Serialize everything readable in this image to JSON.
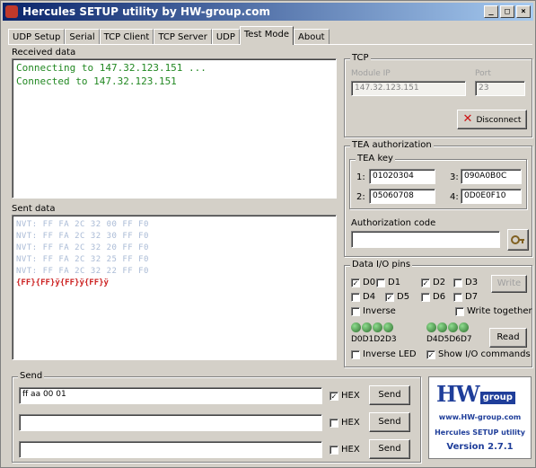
{
  "window": {
    "title": "Hercules SETUP utility by HW-group.com",
    "controls": [
      "_",
      "□",
      "×"
    ]
  },
  "tabs": [
    {
      "label": "UDP Setup",
      "active": false
    },
    {
      "label": "Serial",
      "active": false
    },
    {
      "label": "TCP Client",
      "active": false
    },
    {
      "label": "TCP Server",
      "active": false
    },
    {
      "label": "UDP",
      "active": false
    },
    {
      "label": "Test Mode",
      "active": true
    },
    {
      "label": "About",
      "active": false
    }
  ],
  "received": {
    "label": "Received data",
    "lines": [
      "Connecting to 147.32.123.151 ...",
      "Connected to 147.32.123.151"
    ]
  },
  "sent": {
    "label": "Sent data",
    "lines": [
      "NVT: FF FA 2C 32 00 FF F0",
      "NVT: FF FA 2C 32 30 FF F0",
      "NVT: FF FA 2C 32 20 FF F0",
      "NVT: FF FA 2C 32 25 FF F0",
      "NVT: FF FA 2C 32 22 FF F0"
    ],
    "last_line": "{FF}{FF}ÿ{FF}ÿ{FF}ÿ"
  },
  "tcp": {
    "title": "TCP",
    "module_ip_label": "Module IP",
    "module_ip": "147.32.123.151",
    "port_label": "Port",
    "port": "23",
    "disconnect_label": "Disconnect"
  },
  "tea": {
    "title": "TEA authorization",
    "key_title": "TEA key",
    "keys": [
      {
        "n": "1:",
        "v": "01020304"
      },
      {
        "n": "2:",
        "v": "05060708"
      },
      {
        "n": "3:",
        "v": "090A0B0C"
      },
      {
        "n": "4:",
        "v": "0D0E0F10"
      }
    ],
    "auth_label": "Authorization code",
    "auth_value": ""
  },
  "dataio": {
    "title": "Data I/O pins",
    "pins": [
      {
        "label": "D0",
        "checked": true
      },
      {
        "label": "D1",
        "checked": false
      },
      {
        "label": "D2",
        "checked": true
      },
      {
        "label": "D3",
        "checked": false
      },
      {
        "label": "D4",
        "checked": false
      },
      {
        "label": "D5",
        "checked": true
      },
      {
        "label": "D6",
        "checked": false
      },
      {
        "label": "D7",
        "checked": false
      }
    ],
    "write_label": "Write",
    "inverse_label": "Inverse",
    "write_together_label": "Write together",
    "led_labels_a": "D0D1D2D3",
    "led_labels_b": "D4D5D6D7",
    "read_label": "Read",
    "inverse_led_label": "Inverse LED",
    "show_io_label": "Show I/O commands"
  },
  "send": {
    "title": "Send",
    "rows": [
      {
        "value": "ff aa 00 01",
        "hex": true,
        "hex_label": "HEX",
        "send_label": "Send"
      },
      {
        "value": "",
        "hex": false,
        "hex_label": "HEX",
        "send_label": "Send"
      },
      {
        "value": "",
        "hex": false,
        "hex_label": "HEX",
        "send_label": "Send"
      }
    ]
  },
  "logo": {
    "brand_hw": "HW",
    "brand_group": "group",
    "url": "www.HW-group.com",
    "product": "Hercules SETUP utility",
    "version": "Version 2.7.1"
  },
  "colors": {
    "title_start": "#0a246a",
    "received_text": "#228822",
    "sent_text": "#aabbd6",
    "sent_last": "#cc2222",
    "brand": "#1f3e9a"
  }
}
